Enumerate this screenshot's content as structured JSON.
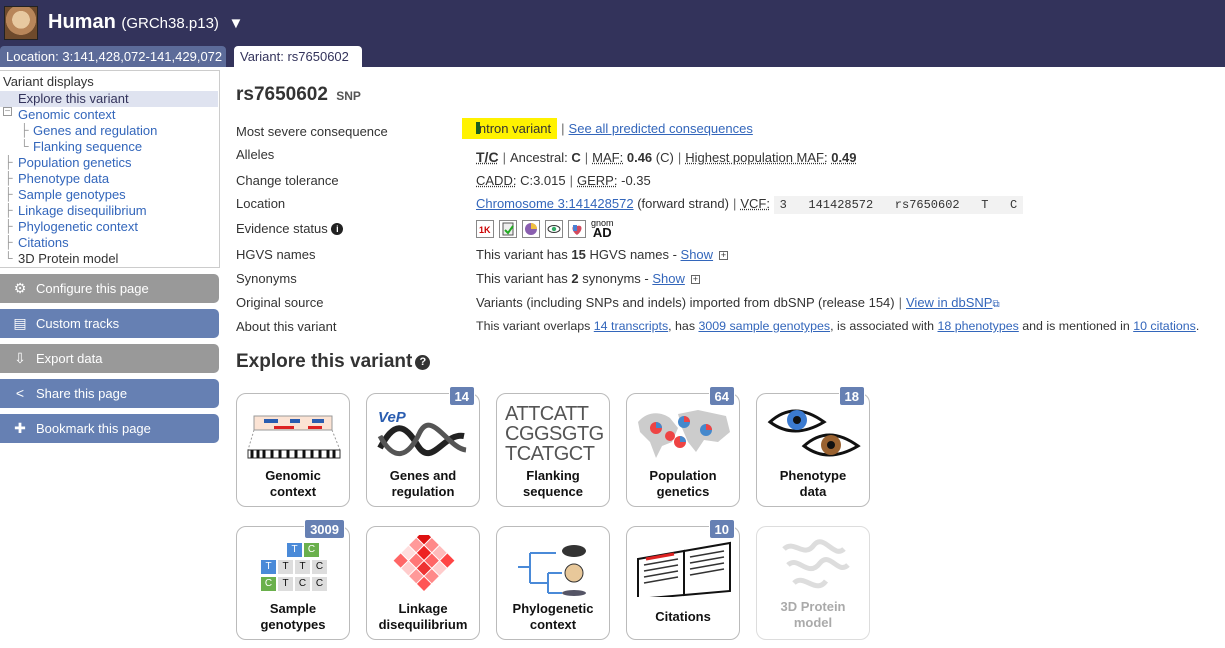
{
  "header": {
    "species": "Human",
    "assembly": "(GRCh38.p13)",
    "caret": "▼",
    "tabs": [
      {
        "label": "Location: 3:141,428,072-141,429,072"
      },
      {
        "label": "Variant: rs7650602"
      }
    ]
  },
  "sidebar": {
    "title": "Variant displays",
    "items": [
      {
        "label": "Explore this variant"
      },
      {
        "label": "Genomic context"
      },
      {
        "label": "Genes and regulation"
      },
      {
        "label": "Flanking sequence"
      },
      {
        "label": "Population genetics"
      },
      {
        "label": "Phenotype data"
      },
      {
        "label": "Sample genotypes"
      },
      {
        "label": "Linkage disequilibrium"
      },
      {
        "label": "Phylogenetic context"
      },
      {
        "label": "Citations"
      },
      {
        "label": "3D Protein model"
      }
    ],
    "buttons": [
      {
        "label": "Configure this page",
        "icon": "gear-icon"
      },
      {
        "label": "Custom tracks",
        "icon": "tracks-icon"
      },
      {
        "label": "Export data",
        "icon": "export-icon"
      },
      {
        "label": "Share this page",
        "icon": "share-icon"
      },
      {
        "label": "Bookmark this page",
        "icon": "bookmark-icon"
      }
    ]
  },
  "variant": {
    "id": "rs7650602",
    "type": "SNP"
  },
  "summary": {
    "consequence": {
      "label": "Most severe consequence",
      "value": "intron variant",
      "link": "See all predicted consequences"
    },
    "alleles": {
      "label": "Alleles",
      "alleles": "T/C",
      "ancestral_label": "Ancestral:",
      "ancestral": "C",
      "maf_label": "MAF:",
      "maf": "0.46",
      "maf_allele": "(C)",
      "hpmaf_label": "Highest population MAF:",
      "hpmaf": "0.49"
    },
    "tolerance": {
      "label": "Change tolerance",
      "cadd_label": "CADD:",
      "cadd": "C:3.015",
      "gerp_label": "GERP:",
      "gerp": "-0.35"
    },
    "location": {
      "label": "Location",
      "chromosome": "Chromosome 3:141428572",
      "strand": "(forward strand)",
      "vcf_label": "VCF:",
      "vcf": "3   141428572   rs7650602   T   C"
    },
    "evidence": {
      "label": "Evidence status",
      "gnomad_top": "gnom",
      "gnomad_bottom": "AD"
    },
    "hgvs": {
      "label": "HGVS names",
      "text_pre": "This variant has",
      "count": "15",
      "text_post": "HGVS names -",
      "show": "Show"
    },
    "synonyms": {
      "label": "Synonyms",
      "text_pre": "This variant has",
      "count": "2",
      "text_post": "synonyms -",
      "show": "Show"
    },
    "source": {
      "label": "Original source",
      "text": "Variants (including SNPs and indels) imported from dbSNP (release 154)",
      "link": "View in dbSNP"
    },
    "about": {
      "label": "About this variant",
      "t1": "This variant overlaps",
      "l1": "14 transcripts",
      "t2": ", has",
      "l2": "3009 sample genotypes",
      "t3": ", is associated with",
      "l3": "18 phenotypes",
      "t4": "and is mentioned in",
      "l4": "10 citations",
      "t5": "."
    }
  },
  "explore": {
    "title": "Explore this variant",
    "cards": [
      {
        "line1": "Genomic",
        "line2": "context",
        "badge": ""
      },
      {
        "line1": "Genes and",
        "line2": "regulation",
        "badge": "14"
      },
      {
        "line1": "Flanking",
        "line2": "sequence",
        "badge": ""
      },
      {
        "line1": "Population",
        "line2": "genetics",
        "badge": "64"
      },
      {
        "line1": "Phenotype",
        "line2": "data",
        "badge": "18"
      },
      {
        "line1": "Sample",
        "line2": "genotypes",
        "badge": "3009"
      },
      {
        "line1": "Linkage",
        "line2": "disequilibrium",
        "badge": ""
      },
      {
        "line1": "Phylogenetic",
        "line2": "context",
        "badge": ""
      },
      {
        "line1": "Citations",
        "line2": "",
        "badge": "10"
      },
      {
        "line1": "3D Protein",
        "line2": "model",
        "badge": ""
      }
    ],
    "flanking_seq": [
      "ATTCATT",
      "CGGSGTG",
      "TCATGCT"
    ],
    "genotype_grid": [
      "T",
      "C",
      "T",
      "T",
      "T",
      "C",
      "C",
      "T",
      "C",
      "C",
      "C"
    ]
  },
  "colors": {
    "header_bg": "#33335b",
    "tab_bg": "#5c6b99",
    "link": "#3366bb",
    "badge": "#6680b3",
    "highlight": "#fff200",
    "button_grey": "#999999",
    "button_blue": "#6680b3"
  }
}
